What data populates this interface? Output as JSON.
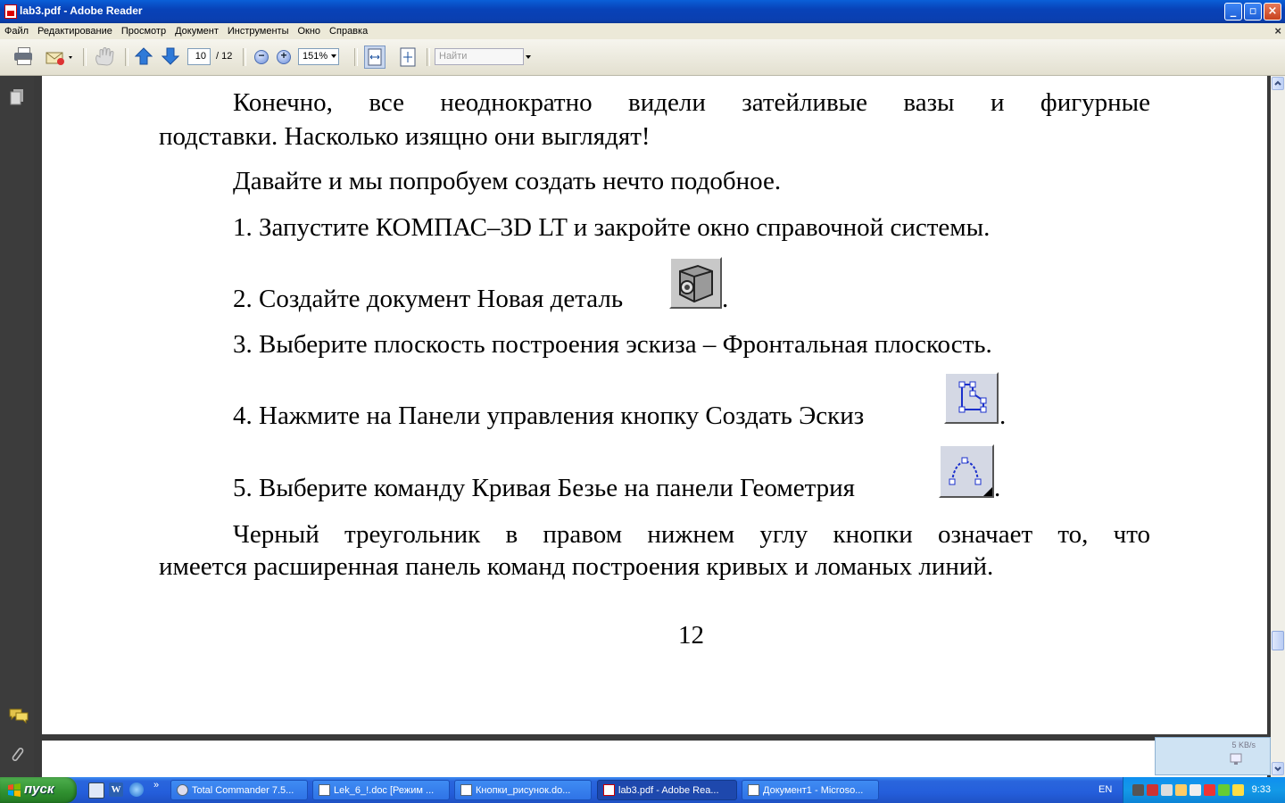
{
  "window": {
    "title": "lab3.pdf - Adobe Reader",
    "minimize_glyph": "_",
    "maximize_glyph": "▫",
    "close_glyph": "×"
  },
  "menu": {
    "items": [
      "Файл",
      "Редактирование",
      "Просмотр",
      "Документ",
      "Инструменты",
      "Окно",
      "Справка"
    ],
    "close_doc_glyph": "×"
  },
  "toolbar": {
    "page_current": "10",
    "page_total": "/ 12",
    "zoom_out_glyph": "−",
    "zoom_in_glyph": "+",
    "zoom_level": "151%",
    "search_placeholder": "Найти"
  },
  "document": {
    "para1_line1": "Конечно, все неоднократно видели затейливые вазы и фигурные",
    "para1_line2": "подставки. Насколько изящно они выглядят!",
    "para2": "Давайте и мы попробуем создать нечто подобное.",
    "step1": "1. Запустите КОМПАС–3D LT и закройте окно справочной системы.",
    "step2": "2. Создайте документ Новая деталь",
    "step2_end": ".",
    "step3": "3. Выберите плоскость построения эскиза – Фронтальная плоскость.",
    "step4": "4. Нажмите на Панели управления кнопку Создать Эскиз",
    "step4_end": ".",
    "step5": "5. Выберите команду Кривая Безье на панели Геометрия",
    "step5_end": ".",
    "para3_line1": "Черный треугольник в правом нижнем углу кнопки означает то, что",
    "para3_line2": "имеется расширенная панель команд построения кривых и ломаных линий.",
    "page_number": "12"
  },
  "net_popup": {
    "rate": "5 KB/s"
  },
  "taskbar": {
    "start_label": "пуск",
    "ql_more": "»",
    "tasks": [
      "Total Commander 7.5...",
      "Lek_6_!.doc [Режим ...",
      "Кнопки_рисунок.do...",
      "lab3.pdf - Adobe Rea...",
      "Документ1 - Microso..."
    ],
    "language": "EN",
    "clock": "9:33"
  },
  "colors": {
    "titlebar": "#0842b8",
    "taskbar": "#245edb",
    "start": "#2f8f2f",
    "nav_panel": "#3c3c3c",
    "page_bg": "#ffffff"
  }
}
